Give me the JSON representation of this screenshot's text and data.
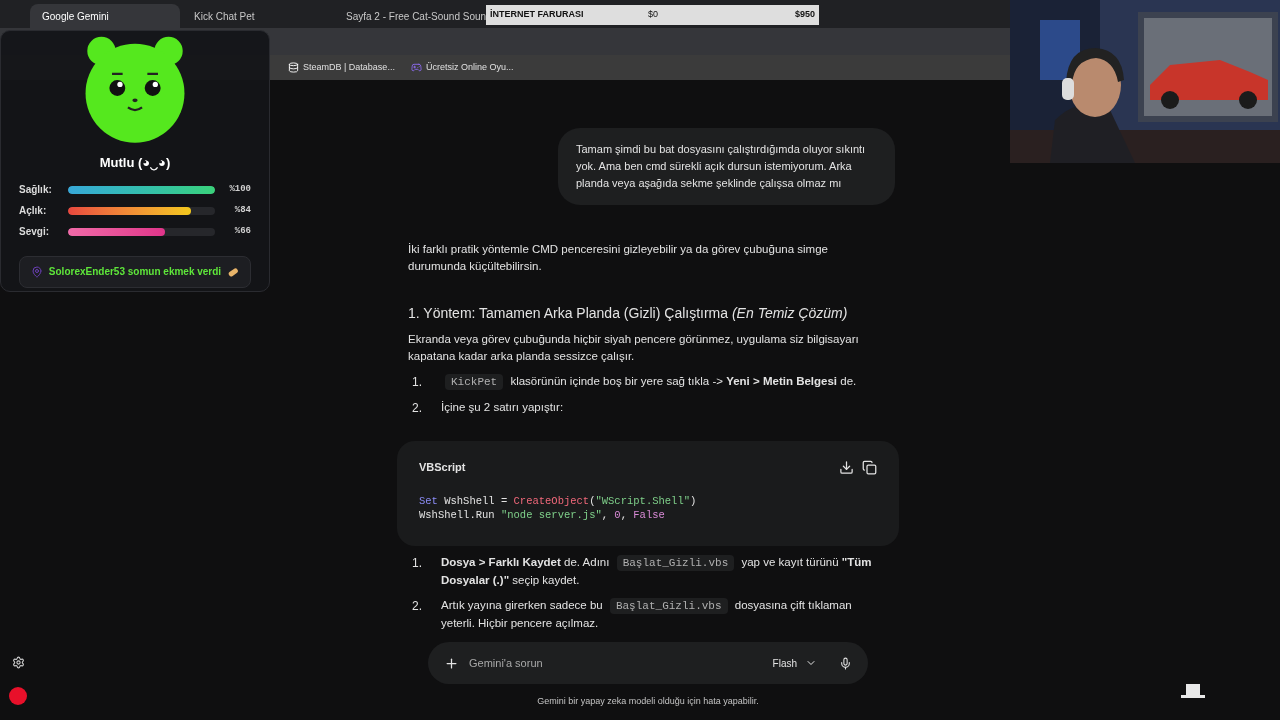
{
  "browser": {
    "tabs": [
      {
        "title": "Google Gemini",
        "selected": true
      },
      {
        "title": "Kick Chat Pet",
        "selected": false
      },
      {
        "title": "Sayfa 2 - Free Cat-Sound Soun",
        "selected": false
      }
    ],
    "bookmarks": [
      "SteamDB | Database...",
      "Ücretsiz Online Oyu..."
    ]
  },
  "goal_bar": {
    "label": "İNTERNET FARURASI",
    "current": "$0",
    "target": "$950",
    "level": 0
  },
  "pet_overlay": {
    "mood": "Mutlu (◕‿◕)",
    "stats": [
      {
        "label": "Sağlık:",
        "level": 1,
        "reading": "%100",
        "kind": "health"
      },
      {
        "label": "Açlık:",
        "level": 0.84,
        "reading": "%84",
        "kind": "hunger"
      },
      {
        "label": "Sevgi:",
        "level": 0.66,
        "reading": "%66",
        "kind": "love"
      }
    ],
    "event": "SolorexEnder53 somun ekmek verdi"
  },
  "chat": {
    "user_message": "Tamam şimdi bu bat dosyasını çalıştırdığımda oluyor sıkıntı yok. Ama ben cmd sürekli açık dursun istemiyorum. Arka planda veya aşağıda sekme şeklinde çalışsa olmaz mı",
    "response": [
      {
        "kind": "paragraph",
        "text": "İki farklı pratik yöntemle CMD penceresini gizleyebilir ya da görev çubuğuna simge durumunda küçültebilirsin."
      },
      {
        "kind": "heading",
        "text": "1. Yöntem: Tamamen Arka Planda (Gizli) Çalıştırma *(En Temiz Çözüm)*"
      },
      {
        "kind": "paragraph",
        "text": "Ekranda veya görev çubuğunda hiçbir siyah pencere görünmez, uygulama siz bilgisayarı kapatana kadar arka planda sessizce çalışır."
      },
      {
        "kind": "list",
        "items": [
          {
            "number": "1.",
            "parts": [
              {
                "kind": "code",
                "text": "KickPet"
              },
              {
                "kind": "text",
                "text": " klasörünün içinde boş bir yere sağ tıkla -> **Yeni > Metin Belgesi** de."
              }
            ]
          },
          {
            "number": "2.",
            "parts": [
              {
                "kind": "text",
                "text": "İçine şu 2 satırı yapıştır:"
              }
            ]
          }
        ]
      },
      {
        "kind": "code",
        "language": "VBScript",
        "lines": [
          [
            {
              "kind": "keyword",
              "text": "Set"
            },
            {
              "kind": "plain",
              "text": " WshShell = "
            },
            {
              "kind": "function",
              "text": "CreateObject"
            },
            {
              "kind": "plain",
              "text": "("
            },
            {
              "kind": "string",
              "text": "\"WScript.Shell\""
            },
            {
              "kind": "plain",
              "text": ")"
            }
          ],
          [
            {
              "kind": "plain",
              "text": "WshShell.Run "
            },
            {
              "kind": "string",
              "text": "\"node server.js\""
            },
            {
              "kind": "plain",
              "text": ", "
            },
            {
              "kind": "number",
              "text": "0"
            },
            {
              "kind": "plain",
              "text": ", "
            },
            {
              "kind": "number",
              "text": "False"
            }
          ]
        ]
      },
      {
        "kind": "list",
        "items": [
          {
            "number": "1.",
            "parts": [
              {
                "kind": "text",
                "text": "**Dosya > Farklı Kaydet** de. Adını "
              },
              {
                "kind": "code",
                "text": "Başlat_Gizli.vbs"
              },
              {
                "kind": "text",
                "text": " yap ve kayıt türünü **\"Tüm Dosyalar (.)\"** seçip kaydet."
              }
            ]
          },
          {
            "number": "2.",
            "parts": [
              {
                "kind": "text",
                "text": "Artık yayına girerken sadece bu "
              },
              {
                "kind": "code",
                "text": "Başlat_Gizli.vbs"
              },
              {
                "kind": "text",
                "text": " dosyasına çift tıklaman yeterli. Hiçbir pencere açılmaz."
              }
            ]
          }
        ]
      }
    ]
  },
  "composer": {
    "placeholder": "Gemini'a sorun",
    "model": "Flash"
  },
  "disclaimer": "Gemini bir yapay zeka modeli olduğu için hata yapabilir."
}
